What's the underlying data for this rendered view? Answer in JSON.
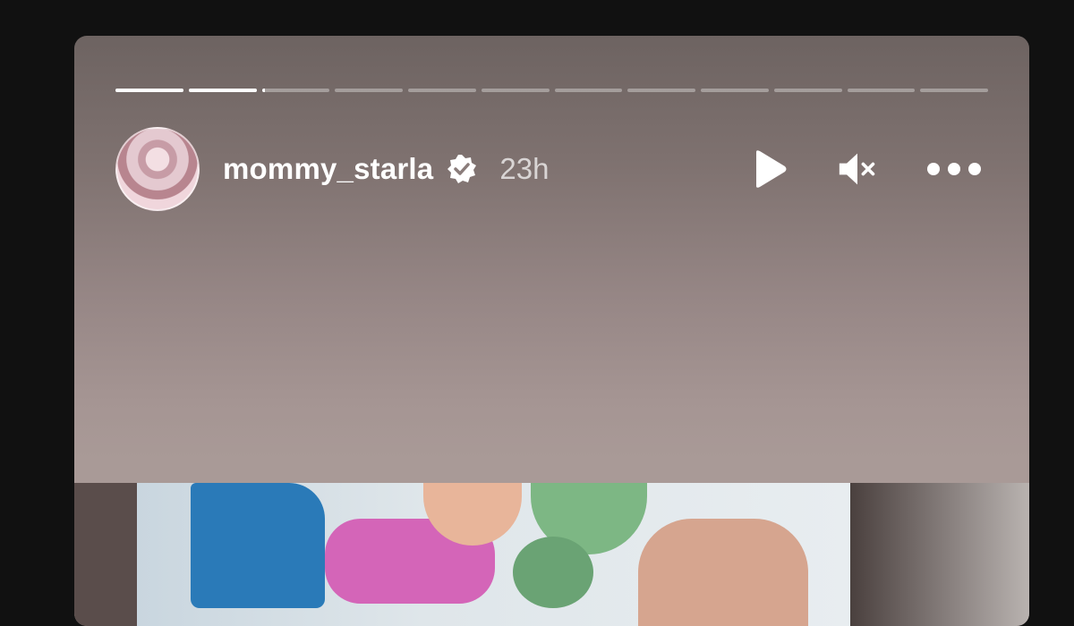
{
  "story": {
    "username": "mommy_starla",
    "verified": true,
    "time": "23h",
    "progress": {
      "segments": [
        1,
        1,
        0.05,
        0,
        0,
        0,
        0,
        0,
        0,
        0,
        0,
        0
      ]
    },
    "controls": {
      "play_icon": "play-icon",
      "mute_icon": "speaker-muted-icon",
      "more_icon": "more-horizontal-icon"
    },
    "media_icon": "photo"
  }
}
